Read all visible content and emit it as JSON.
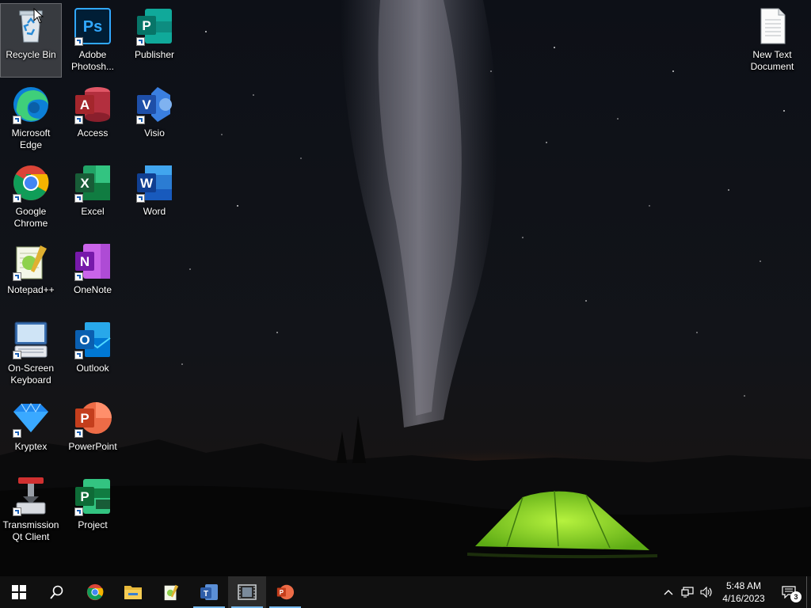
{
  "desktop": {
    "icons": [
      {
        "id": "recycle-bin",
        "label": "Recycle Bin"
      },
      {
        "id": "photoshop",
        "label": "Adobe Photosh..."
      },
      {
        "id": "publisher",
        "label": "Publisher"
      },
      {
        "id": "edge",
        "label": "Microsoft Edge"
      },
      {
        "id": "access",
        "label": "Access"
      },
      {
        "id": "visio",
        "label": "Visio"
      },
      {
        "id": "chrome",
        "label": "Google Chrome"
      },
      {
        "id": "excel",
        "label": "Excel"
      },
      {
        "id": "word",
        "label": "Word"
      },
      {
        "id": "notepadpp",
        "label": "Notepad++"
      },
      {
        "id": "onenote",
        "label": "OneNote"
      },
      {
        "id": "osk",
        "label": "On-Screen Keyboard"
      },
      {
        "id": "outlook",
        "label": "Outlook"
      },
      {
        "id": "kryptex",
        "label": "Kryptex"
      },
      {
        "id": "powerpoint",
        "label": "PowerPoint"
      },
      {
        "id": "transmission",
        "label": "Transmission Qt Client"
      },
      {
        "id": "project",
        "label": "Project"
      },
      {
        "id": "new-text-doc",
        "label": "New Text Document"
      }
    ],
    "app_letters": {
      "photoshop": "Ps",
      "publisher": "P",
      "access": "A",
      "visio": "V",
      "excel": "X",
      "word": "W",
      "onenote": "N",
      "outlook": "O",
      "powerpoint": "P",
      "project": "P"
    }
  },
  "taskbar": {
    "apps": [
      {
        "name": "start-button-icon"
      },
      {
        "name": "search-icon"
      },
      {
        "name": "chrome-icon"
      },
      {
        "name": "file-explorer-icon"
      },
      {
        "name": "notepadpp-icon"
      },
      {
        "name": "teams-icon"
      },
      {
        "name": "video-player-icon"
      },
      {
        "name": "powerpoint-icon"
      }
    ],
    "clock": {
      "time": "5:48 AM",
      "date": "4/16/2023"
    },
    "notification_count": "3"
  },
  "colors": {
    "taskbar_bg": "#101010",
    "running_indicator": "#76b9ed",
    "tent_green": "#7fd72a"
  }
}
